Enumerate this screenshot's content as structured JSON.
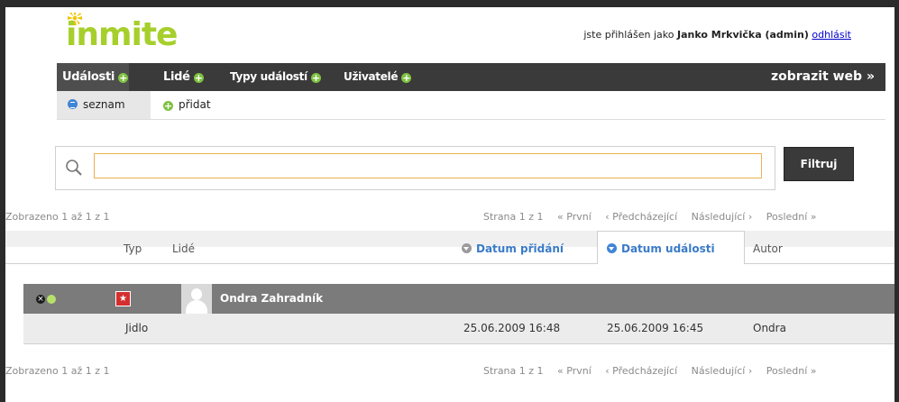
{
  "brand": {
    "logo_text": "inmite",
    "accent": "#a6cf2c"
  },
  "user": {
    "prefix": "jste přihlášen jako",
    "name": "Janko Mrkvička (admin)",
    "logout": "odhlásit"
  },
  "mainnav": {
    "items": [
      {
        "label": "Události"
      },
      {
        "label": "Lidé"
      },
      {
        "label": "Typy událostí"
      },
      {
        "label": "Uživatelé"
      }
    ],
    "web_link": "zobrazit web »"
  },
  "subnav": {
    "list_label": "seznam",
    "add_label": "přidat"
  },
  "search": {
    "value": "",
    "button": "Filtruj"
  },
  "listing": {
    "count_text": "Zobrazeno 1 až 1 z 1",
    "pager": {
      "page": "Strana 1 z 1",
      "first": "« První",
      "prev": "‹ Předcházející",
      "next": "Následující ›",
      "last": "Poslední »"
    }
  },
  "table": {
    "headers": {
      "typ": "Typ",
      "lide": "Lidé",
      "datum_pridani": "Datum přidání",
      "datum_udalosti": "Datum události",
      "autor": "Autor"
    },
    "rows": [
      {
        "person": "Ondra Zahradník",
        "type": "Jidlo",
        "added": "25.06.2009 16:48",
        "event": "25.06.2009 16:45",
        "author": "Ondra"
      }
    ]
  }
}
